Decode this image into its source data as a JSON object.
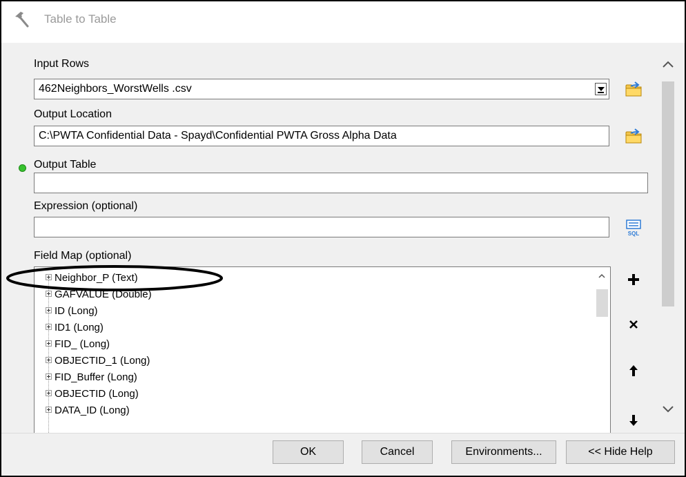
{
  "window": {
    "title": "Table to Table",
    "icon": "hammer-icon"
  },
  "form": {
    "input_rows": {
      "label": "Input Rows",
      "value": "462Neighbors_WorstWells .csv"
    },
    "output_location": {
      "label": "Output Location",
      "value": "C:\\PWTA Confidential Data - Spayd\\Confidential PWTA Gross Alpha Data"
    },
    "output_table": {
      "label": "Output Table",
      "value": ""
    },
    "expression": {
      "label": "Expression (optional)",
      "value": ""
    },
    "field_map": {
      "label": "Field Map (optional)",
      "items": [
        "Neighbor_P (Text)",
        "GAFVALUE (Double)",
        "ID (Long)",
        "ID1 (Long)",
        "FID_ (Long)",
        "OBJECTID_1 (Long)",
        "FID_Buffer (Long)",
        "OBJECTID (Long)",
        "DATA_ID (Long)"
      ]
    }
  },
  "buttons": {
    "ok": "OK",
    "cancel": "Cancel",
    "environments": "Environments...",
    "hide_help": "<< Hide Help"
  },
  "colors": {
    "required_indicator": "#37c22f",
    "annotation": "#000000"
  }
}
